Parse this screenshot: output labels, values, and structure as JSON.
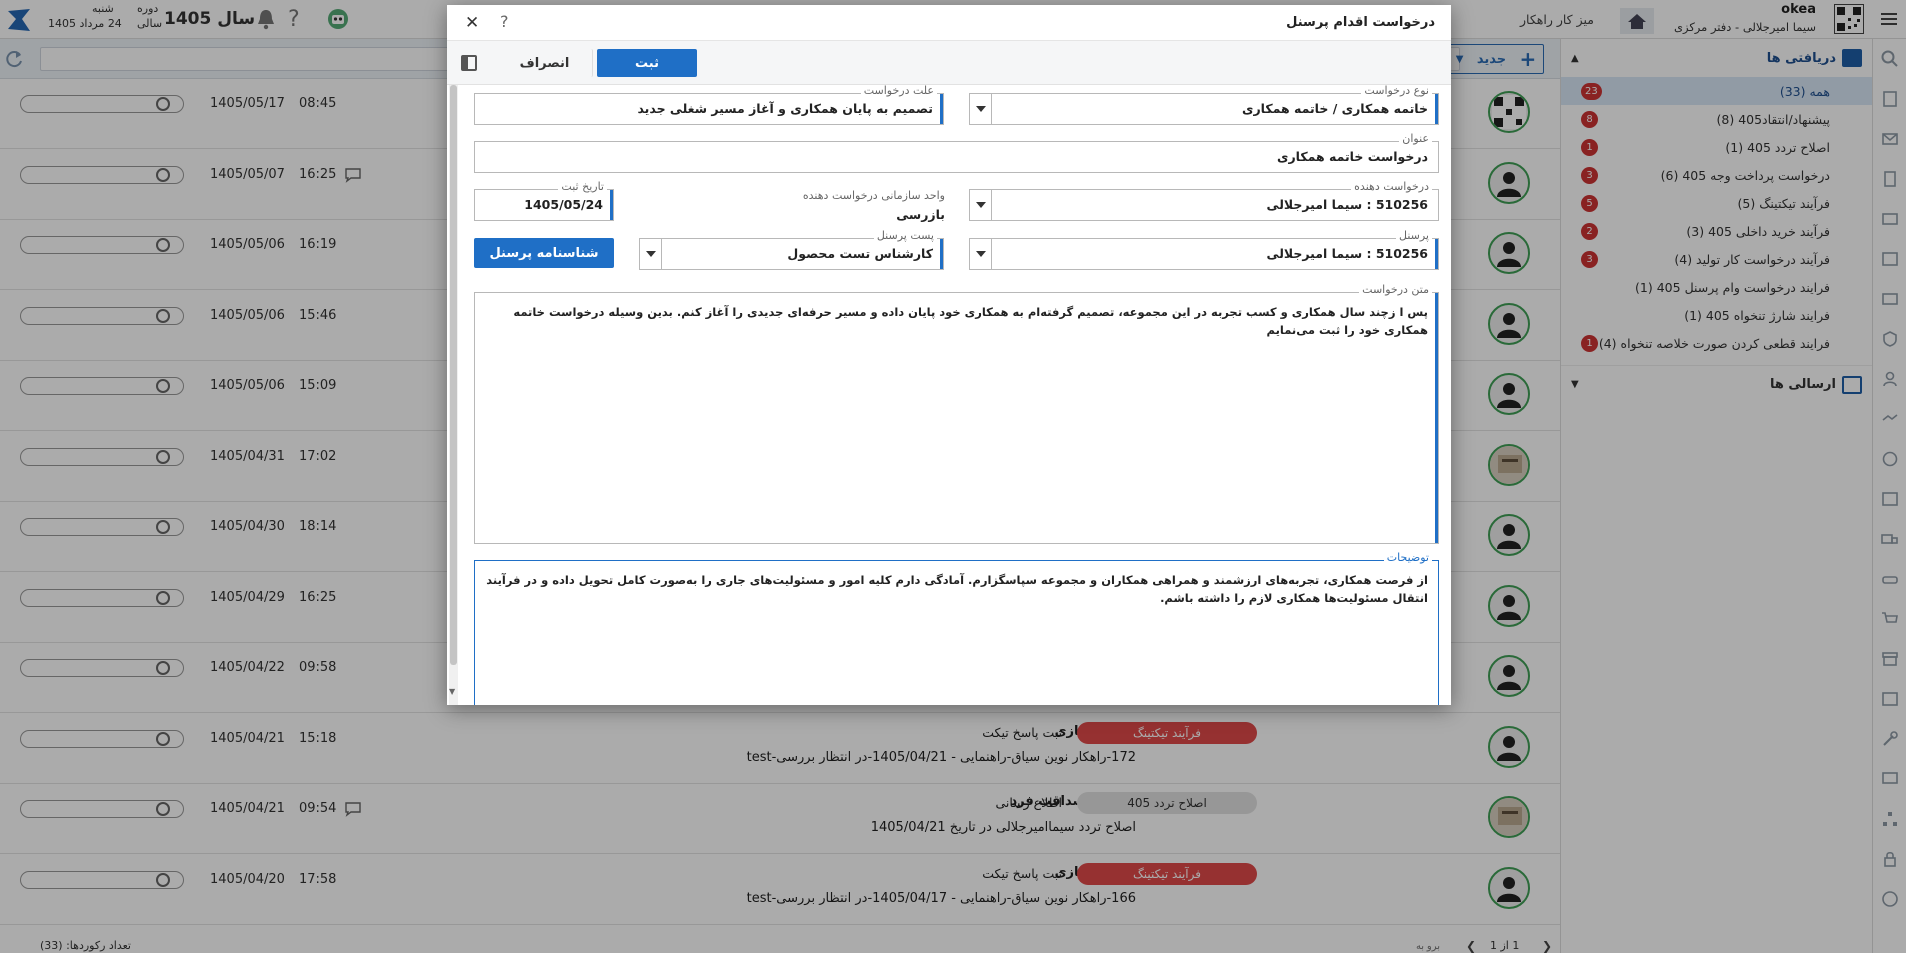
{
  "topbar": {
    "app_name": "okea",
    "user_line": "سیما امیرجلالی - دفتر مرکزی",
    "desk_label": "میز کار راهکار",
    "year_label": "سال 1405",
    "period_top": "دوره",
    "period_bottom": "سالی",
    "weekday": "شنبه",
    "date_text": "24 مرداد 1405"
  },
  "toolbar": {
    "new_label": "جدید"
  },
  "sidebar": {
    "received_label": "دریافتی ها",
    "sent_label": "ارسالی ها",
    "items": [
      {
        "label": "همه (33)",
        "badge": "23"
      },
      {
        "label": "پیشنهاد/انتقاد405 (8)",
        "badge": "8"
      },
      {
        "label": "اصلاح تردد 405 (1)",
        "badge": "1"
      },
      {
        "label": "درخواست پرداخت وجه 405 (6)",
        "badge": "3"
      },
      {
        "label": "فرآیند تیکتینگ (5)",
        "badge": "5"
      },
      {
        "label": "فرآیند خرید داخلی 405 (3)",
        "badge": "2"
      },
      {
        "label": "فرآیند درخواست کار تولید (4)",
        "badge": "3"
      },
      {
        "label": "فرایند درخواست وام پرسنل 405 (1)",
        "badge": ""
      },
      {
        "label": "فرایند شارژ تنخواه 405 (1)",
        "badge": ""
      },
      {
        "label": "فرایند قطعی کردن صورت خلاصه تنخواه (4)",
        "badge": "1"
      }
    ]
  },
  "list": {
    "rows": [
      {
        "date": "1405/05/17",
        "time": "08:45",
        "chat": false,
        "name": "",
        "tag": "",
        "tag_style": "",
        "tag_desc": "",
        "sub": "",
        "avatar": "qr"
      },
      {
        "date": "1405/05/07",
        "time": "16:25",
        "chat": true,
        "name": "",
        "tag": "",
        "tag_style": "",
        "tag_desc": "",
        "sub": "",
        "avatar": "person"
      },
      {
        "date": "1405/05/06",
        "time": "16:19",
        "chat": false,
        "name": "",
        "tag": "",
        "tag_style": "",
        "tag_desc": "",
        "sub": "",
        "avatar": "person"
      },
      {
        "date": "1405/05/06",
        "time": "15:46",
        "chat": false,
        "name": "",
        "tag": "",
        "tag_style": "",
        "tag_desc": "",
        "sub": "",
        "avatar": "person"
      },
      {
        "date": "1405/05/06",
        "time": "15:09",
        "chat": false,
        "name": "",
        "tag": "",
        "tag_style": "",
        "tag_desc": "",
        "sub": "",
        "avatar": "person"
      },
      {
        "date": "1405/04/31",
        "time": "17:02",
        "chat": false,
        "name": "",
        "tag": "",
        "tag_style": "",
        "tag_desc": "",
        "sub": "",
        "avatar": "photo"
      },
      {
        "date": "1405/04/30",
        "time": "18:14",
        "chat": false,
        "name": "",
        "tag": "",
        "tag_style": "",
        "tag_desc": "",
        "sub": "",
        "avatar": "person"
      },
      {
        "date": "1405/04/29",
        "time": "16:25",
        "chat": false,
        "name": "",
        "tag": "",
        "tag_style": "",
        "tag_desc": "",
        "sub": "",
        "avatar": "person"
      },
      {
        "date": "1405/04/22",
        "time": "09:58",
        "chat": false,
        "name": "",
        "tag": "",
        "tag_style": "",
        "tag_desc": "",
        "sub": "",
        "avatar": "person"
      },
      {
        "date": "1405/04/21",
        "time": "15:18",
        "chat": false,
        "name": "امیر شهبازی",
        "tag": "فرآیند تیکتینگ",
        "tag_style": "red",
        "tag_desc": "ثبت پاسخ تیکت",
        "sub": "172-راهکار نوین سیاق-راهنمایی - 1405/04/21-در انتظار بررسی-test",
        "avatar": "person"
      },
      {
        "date": "1405/04/21",
        "time": "09:54",
        "chat": true,
        "name": "ابراهیم صداقت فرد",
        "tag": "اصلاح تردد 405",
        "tag_style": "gray",
        "tag_desc": "اطلاع رسانی",
        "sub": "اصلاح تردد سیماامیرجلالی در تاریخ 1405/04/21",
        "avatar": "photo"
      },
      {
        "date": "1405/04/20",
        "time": "17:58",
        "chat": false,
        "name": "امیر شهبازی",
        "tag": "فرآیند تیکتینگ",
        "tag_style": "red",
        "tag_desc": "ثبت پاسخ تیکت",
        "sub": "166-راهکار نوین سیاق-راهنمایی - 1405/04/17-در انتظار بررسی-test",
        "avatar": "person"
      }
    ]
  },
  "statusbar": {
    "count_text": "تعداد رکوردها: (33)",
    "pager_text": "1 از 1",
    "goto_placeholder": "برو به"
  },
  "modal": {
    "title": "درخواست اقدام پرسنل",
    "submit_label": "ثبت",
    "cancel_label": "انصراف",
    "request_type_label": "نوع درخواست",
    "request_type_value": "خاتمه همکاری / خاتمه همکاری",
    "reason_label": "علت درخواست",
    "reason_value": "تصمیم به پایان همکاری و آغاز مسیر شغلی جدید",
    "subject_label": "عنوان",
    "subject_value": "درخواست خاتمه همکاری",
    "requester_label": "درخواست دهنده",
    "requester_value": "510256 : سیما امیرجلالی",
    "org_unit_label": "واحد سازمانی درخواست دهنده",
    "org_unit_value": "بازرسی",
    "reg_date_label": "تاریخ ثبت",
    "reg_date_value": "1405/05/24",
    "personnel_label": "پرسنل",
    "personnel_value": "510256 : سیما امیرجلالی",
    "post_label": "پست پرسنل",
    "post_value": "کارشناس تست محصول",
    "identity_button": "شناسنامه پرسنل",
    "body_label": "متن درخواست",
    "body_value": "پس ا زچند سال همکاری و کسب تجربه در این مجموعه، تصمیم گرفته‌ام به همکاری خود پایان داده و مسیر حرفه‌ای جدیدی را آغاز کنم. بدین وسیله درخواست خاتمه همکاری خود را ثبت می‌نمایم",
    "notes_label": "توضیحات",
    "notes_value": "از فرصت همکاری، تجربه‌های ارزشمند و همراهی همکاران و مجموعه سپاسگزارم. آمادگی دارم کلیه امور و مسئولیت‌های جاری را به‌صورت کامل تحویل داده و در فرآیند انتقال مسئولیت‌ها همکاری لازم را داشته باشم."
  },
  "colors": {
    "primary": "#1f6fc6",
    "badge": "#cc3333",
    "tag_red": "#e04a4a",
    "avatar_ring": "#3f9f55"
  }
}
